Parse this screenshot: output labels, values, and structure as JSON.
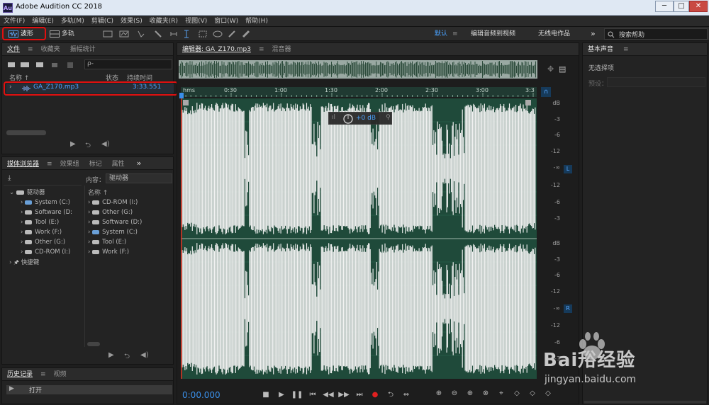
{
  "window": {
    "app_icon_label": "Au",
    "title": "Adobe Audition CC 2018",
    "min_label": "─",
    "max_label": "□",
    "close_label": "✕"
  },
  "menu": [
    "文件(F)",
    "编辑(E)",
    "多轨(M)",
    "剪辑(C)",
    "效果(S)",
    "收藏夹(R)",
    "视图(V)",
    "窗口(W)",
    "帮助(H)"
  ],
  "toolbar": {
    "waveform_label": "波形",
    "multitrack_label": "多轨",
    "workspace_default": "默认",
    "workspace_video": "编辑音频到视频",
    "workspace_radio": "无线电作品",
    "overflow": "»",
    "search_placeholder": "搜索帮助"
  },
  "files_panel": {
    "tabs": [
      "文件",
      "收藏夹",
      "振幅统计"
    ],
    "search_placeholder": "ρ-",
    "col_name": "名称 ↑",
    "col_status": "状态",
    "col_duration": "持续时间",
    "file": {
      "name": "GA_Z170.mp3",
      "duration": "3:33.551"
    }
  },
  "media_panel": {
    "tabs": [
      "媒体浏览器",
      "效果组",
      "标记",
      "属性"
    ],
    "overflow": "»",
    "content_label": "内容：",
    "content_value": "驱动器",
    "col_name": "名称 ↑",
    "tree_root": "驱动器",
    "tree_drives": [
      "System (C:)",
      "Software (D:",
      "Tool (E:)",
      "Work (F:)",
      "Other (G:)",
      "CD-ROM (I:)"
    ],
    "tree_shortcuts": "快捷键",
    "list_drives": [
      "CD-ROM (I:)",
      "Other (G:)",
      "Software (D:)",
      "System (C:)",
      "Tool (E:)",
      "Work (F:)"
    ]
  },
  "history_panel": {
    "tabs": [
      "历史记录",
      "视频"
    ],
    "item": "打开"
  },
  "editor": {
    "tabs": [
      "编辑器: GA_Z170.mp3",
      "混音器"
    ],
    "time_ticks": [
      "hms",
      "0:30",
      "1:00",
      "1:30",
      "2:00",
      "2:30",
      "3:00",
      "3:3"
    ],
    "hud_value": "+0 dB",
    "db_left": [
      "dB",
      "-3",
      "-6",
      "-12",
      "-∞",
      "-12",
      "-6",
      "-3"
    ],
    "db_right": [
      "dB",
      "-3",
      "-6",
      "-12",
      "-∞",
      "-12",
      "-6",
      "-3"
    ],
    "ch_left": "L",
    "ch_right": "R",
    "current_time": "0:00.000"
  },
  "essential_sound": {
    "title": "基本声音",
    "no_selection": "无选择项",
    "preset_label": "预设："
  },
  "watermark": {
    "logo_text": "Bai谸经验",
    "url": "jingyan.baidu.com"
  },
  "colors": {
    "waveform_bg": "#1f4a3a",
    "waveform": "#f2f2f2",
    "accent": "#3a8fe8",
    "highlight": "#e01010"
  }
}
